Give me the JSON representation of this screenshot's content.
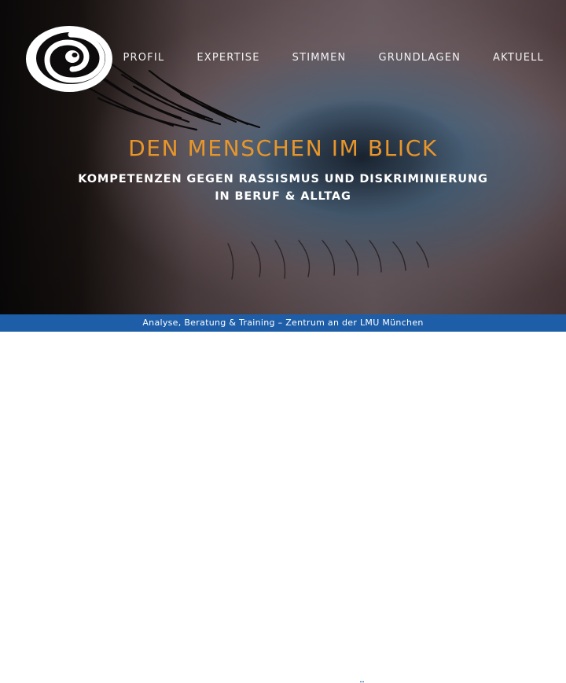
{
  "logo": {
    "icon": "eye-swirl-logo-icon"
  },
  "nav": {
    "items": [
      {
        "label": "PROFIL"
      },
      {
        "label": "EXPERTISE"
      },
      {
        "label": "STIMMEN"
      },
      {
        "label": "GRUNDLAGEN"
      },
      {
        "label": "AKTUELL"
      }
    ]
  },
  "hero": {
    "headline": "DEN MENSCHEN IM BLICK",
    "subline_1": "KOMPETENZEN GEGEN RASSISMUS UND DISKRIMINIERUNG",
    "subline_2": "IN BERUF & ALLTAG"
  },
  "bar": {
    "text": "Analyse, Beratung & Training – Zentrum an der LMU München"
  },
  "colors": {
    "headline": "#e8962a",
    "bar": "#1e5ea8",
    "nav_text": "#f2f2f2"
  }
}
